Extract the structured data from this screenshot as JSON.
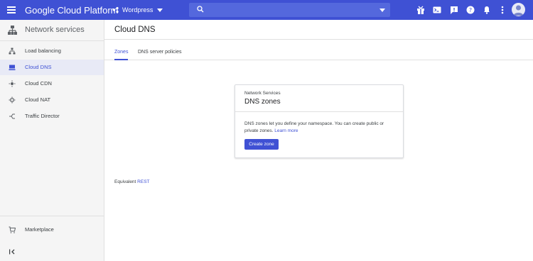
{
  "topbar": {
    "brand": "Google Cloud Platform",
    "project": "Wordpress",
    "search_placeholder": "",
    "icons": [
      "gift-icon",
      "terminal-icon",
      "help-feedback-icon",
      "help-icon",
      "notifications-icon",
      "more-vert-icon",
      "avatar"
    ]
  },
  "sidebar": {
    "title": "Network services",
    "items": [
      {
        "label": "Load balancing",
        "icon": "load-balancing-icon"
      },
      {
        "label": "Cloud DNS",
        "icon": "dns-icon",
        "active": true
      },
      {
        "label": "Cloud CDN",
        "icon": "cdn-icon"
      },
      {
        "label": "Cloud NAT",
        "icon": "nat-icon"
      },
      {
        "label": "Traffic Director",
        "icon": "traffic-director-icon"
      }
    ],
    "footer_item": {
      "label": "Marketplace",
      "icon": "marketplace-icon"
    }
  },
  "main": {
    "title": "Cloud DNS",
    "tabs": [
      {
        "label": "Zones",
        "active": true
      },
      {
        "label": "DNS server policies"
      }
    ],
    "card": {
      "eyebrow": "Network Services",
      "heading": "DNS zones",
      "body": "DNS zones let you define your namespace. You can create public or private zones.",
      "link": "Learn more",
      "button": "Create zone"
    },
    "equivalent_label": "Equivalent",
    "equivalent_link": "REST"
  },
  "colors": {
    "brand_blue": "#3f51d4",
    "active_bg": "#e8eaf6"
  }
}
